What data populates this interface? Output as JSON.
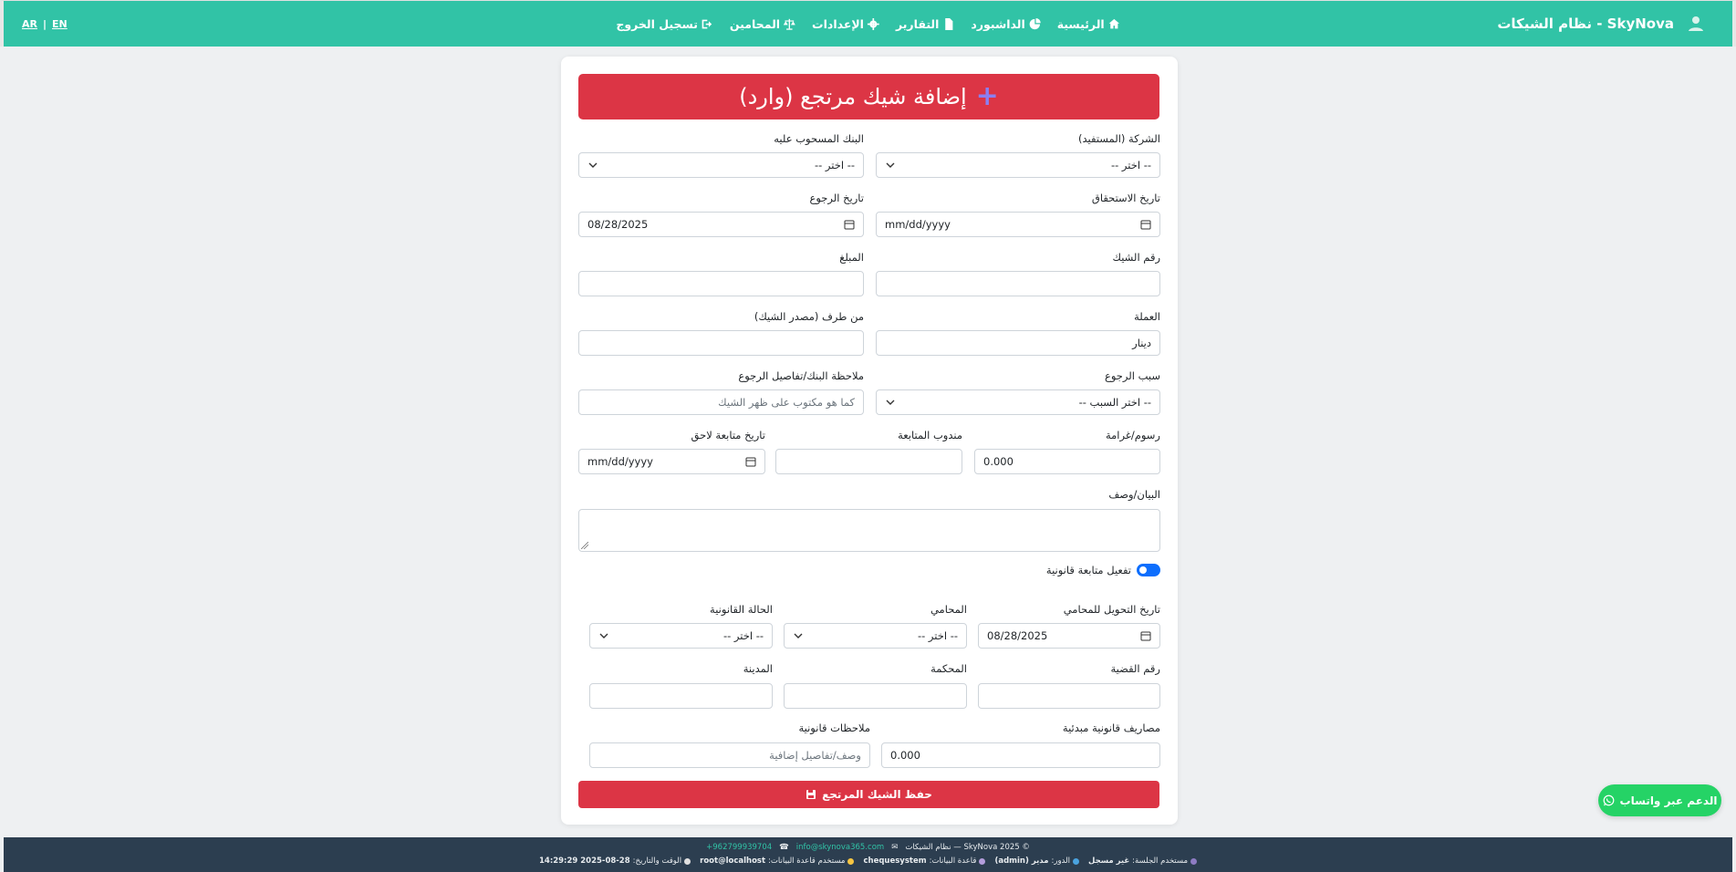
{
  "navbar": {
    "brand": "SkyNova - نظام الشيكات",
    "links": [
      {
        "label": "الرئيسية",
        "icon": "home-icon"
      },
      {
        "label": "الداشبورد",
        "icon": "pie-chart-icon"
      },
      {
        "label": "التقارير",
        "icon": "file-icon"
      },
      {
        "label": "الإعدادات",
        "icon": "gear-icon"
      },
      {
        "label": "المحامين",
        "icon": "scale-icon"
      },
      {
        "label": "تسجيل الخروج",
        "icon": "logout-icon"
      }
    ],
    "lang_ar": "AR",
    "lang_en": "EN",
    "lang_sep": "|"
  },
  "form": {
    "title": "إضافة شيك مرتجع (وارد)",
    "company_label": "الشركة (المستفيد)",
    "company_value": "-- اختر --",
    "bank_label": "البنك المسحوب عليه",
    "bank_value": "-- اختر --",
    "due_date_label": "تاريخ الاستحقاق",
    "due_date_value": "mm/dd/yyyy",
    "return_date_label": "تاريخ الرجوع",
    "return_date_value": "08/28/2025",
    "cheque_number_label": "رقم الشيك",
    "cheque_number_value": "",
    "amount_label": "المبلغ",
    "amount_value": "",
    "currency_label": "العملة",
    "currency_value": "دينار",
    "from_label": "من طرف (مصدر الشيك)",
    "from_value": "",
    "return_reason_label": "سبب الرجوع",
    "return_reason_value": "-- اختر السبب --",
    "bank_note_label": "ملاحظة البنك/تفاصيل الرجوع",
    "bank_note_placeholder": "كما هو مكتوب على ظهر الشيك",
    "fees_label": "رسوم/غرامة",
    "fees_value": "0.000",
    "agent_label": "مندوب المتابعة",
    "agent_value": "",
    "followup_date_label": "تاريخ متابعة لاحق",
    "followup_date_value": "mm/dd/yyyy",
    "description_label": "البيان/وصف",
    "legal_toggle_label": "تفعيل متابعة قانونية",
    "legal_toggle_on": true,
    "transfer_date_label": "تاريخ التحويل للمحامي",
    "transfer_date_value": "08/28/2025",
    "lawyer_label": "المحامي",
    "lawyer_value": "-- اختر --",
    "legal_status_label": "الحالة القانونية",
    "legal_status_value": "-- اختر --",
    "case_number_label": "رقم القضية",
    "court_label": "المحكمة",
    "city_label": "المدينة",
    "initial_costs_label": "مصاريف قانونية مبدئية",
    "initial_costs_value": "0.000",
    "legal_notes_label": "ملاحظات قانونية",
    "legal_notes_placeholder": "وصف/تفاصيل إضافية",
    "save_label": "حفظ الشيك المرتجع"
  },
  "footer": {
    "copyright": "© 2025 SkyNova — نظام الشيكات",
    "email": "info@skynova365.com",
    "phone": "+962799939704",
    "session_user_label": "مستخدم الجلسة:",
    "session_user_value": "غير مسجل",
    "role_label": "الدور:",
    "role_value": "مدير (admin)",
    "db_label": "قاعدة البيانات:",
    "db_value": "chequesystem",
    "db_user_label": "مستخدم قاعدة البيانات:",
    "db_user_value": "root@localhost",
    "datetime_label": "الوقت والتاريخ:",
    "datetime_value": "2025-08-28 14:29:29"
  },
  "whatsapp": {
    "label": "الدعم عبر واتساب"
  },
  "colors": {
    "navbar": "#31c3a6",
    "danger": "#dc3545",
    "footer": "#2c3e50",
    "whatsapp": "#25d366",
    "toggle": "#0d6efd"
  }
}
